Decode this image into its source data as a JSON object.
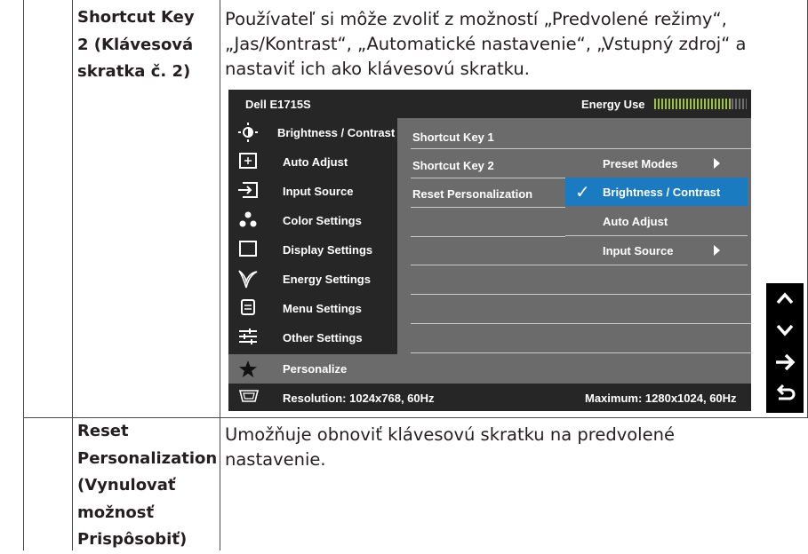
{
  "rows": [
    {
      "term_lines": [
        "Shortcut Key",
        "2 (Klávesová",
        "skratka č. 2)"
      ],
      "description_lines": [
        "Používateľ si môže zvoliť z možností „Predvolené režimy“,",
        "„Jas/Kontrast“, „Automatické nastavenie“, „Vstupný zdroj“ a",
        "nastaviť ich ako klávesovú skratku."
      ]
    },
    {
      "term_lines": [
        "Reset",
        "Personalization",
        "(Vynulovať",
        "možnosť",
        "Prispôsobiť)"
      ],
      "description_lines": [
        "Umožňuje obnoviť klávesovú skratku na predvolené",
        "nastavenie."
      ]
    }
  ],
  "osd": {
    "title": "Dell E1715S",
    "energy_label": "Energy Use",
    "energy_level": 0.84,
    "menu": [
      {
        "label": "Brightness / Contrast",
        "icon": "brightness-icon"
      },
      {
        "label": "Auto Adjust",
        "icon": "auto-adjust-icon"
      },
      {
        "label": "Input Source",
        "icon": "input-source-icon"
      },
      {
        "label": "Color Settings",
        "icon": "color-settings-icon"
      },
      {
        "label": "Display Settings",
        "icon": "display-settings-icon"
      },
      {
        "label": "Energy Settings",
        "icon": "energy-leaf-icon"
      },
      {
        "label": "Menu Settings",
        "icon": "menu-settings-icon"
      },
      {
        "label": "Other Settings",
        "icon": "other-settings-icon"
      },
      {
        "label": "Personalize",
        "icon": "star-icon",
        "selected": true
      }
    ],
    "submenu": [
      "Shortcut Key 1",
      "Shortcut Key 2",
      "Reset Personalization"
    ],
    "options": [
      {
        "label": "Preset Modes",
        "has_arrow": true
      },
      {
        "label": "Brightness / Contrast",
        "checked": true,
        "highlighted": true
      },
      {
        "label": "Auto Adjust"
      },
      {
        "label": "Input Source",
        "has_arrow": true
      }
    ],
    "resolution": "Resolution: 1024x768, 60Hz",
    "maximum": "Maximum: 1280x1024, 60Hz",
    "accent_color": "#1b7bc1"
  },
  "nav_buttons": [
    "up-arrow-icon",
    "down-arrow-icon",
    "right-arrow-icon",
    "back-return-icon"
  ]
}
